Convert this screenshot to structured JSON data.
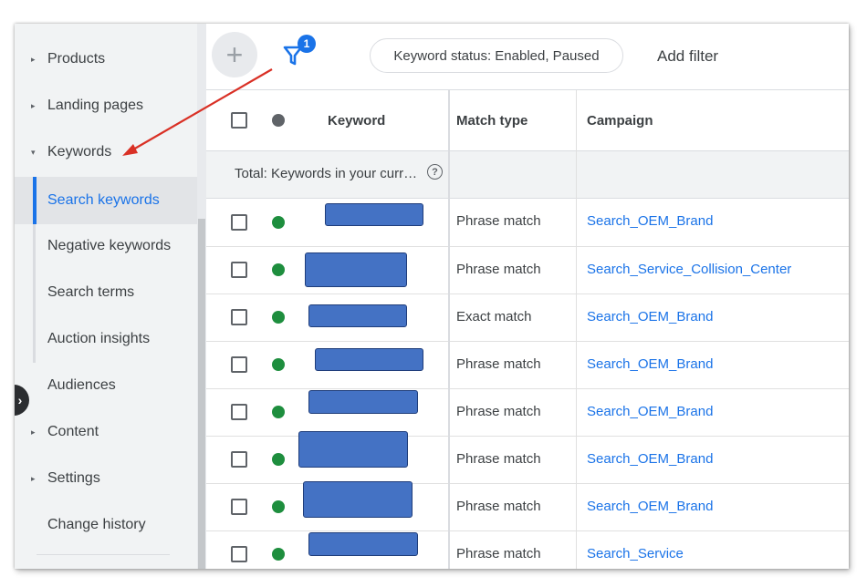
{
  "sidebar": {
    "items": [
      {
        "label": "Products",
        "caret": "▸"
      },
      {
        "label": "Landing pages",
        "caret": "▸"
      },
      {
        "label": "Keywords",
        "caret": "▾"
      },
      {
        "label": "Search keywords"
      },
      {
        "label": "Negative keywords"
      },
      {
        "label": "Search terms"
      },
      {
        "label": "Auction insights"
      },
      {
        "label": "Audiences"
      },
      {
        "label": "Content",
        "caret": "▸"
      },
      {
        "label": "Settings",
        "caret": "▸"
      },
      {
        "label": "Change history"
      }
    ],
    "active_item": "Search keywords",
    "collapse_icon": "›"
  },
  "toolbar": {
    "add_icon": "+",
    "filter_badge": "1",
    "filter_chip": "Keyword status: Enabled, Paused",
    "add_filter": "Add filter"
  },
  "table": {
    "columns": [
      "Keyword",
      "Match type",
      "Campaign"
    ],
    "total_label": "Total: Keywords in your curr…",
    "help_icon": "?",
    "rows": [
      {
        "match": "Phrase match",
        "campaign": "Search_OEM_Brand",
        "status": "enabled"
      },
      {
        "match": "Phrase match",
        "campaign": "Search_Service_Collision_Center",
        "status": "enabled"
      },
      {
        "match": "Exact match",
        "campaign": "Search_OEM_Brand",
        "status": "enabled"
      },
      {
        "match": "Phrase match",
        "campaign": "Search_OEM_Brand",
        "status": "enabled"
      },
      {
        "match": "Phrase match",
        "campaign": "Search_OEM_Brand",
        "status": "enabled"
      },
      {
        "match": "Phrase match",
        "campaign": "Search_OEM_Brand",
        "status": "enabled"
      },
      {
        "match": "Phrase match",
        "campaign": "Search_OEM_Brand",
        "status": "enabled"
      },
      {
        "match": "Phrase match",
        "campaign": "Search_Service",
        "status": "enabled"
      }
    ]
  },
  "colors": {
    "accent": "#1a73e8",
    "status_enabled": "#1e8e3e",
    "status_header": "#5f6368",
    "redaction": "#4472c4",
    "annotation_arrow": "#d93025"
  }
}
